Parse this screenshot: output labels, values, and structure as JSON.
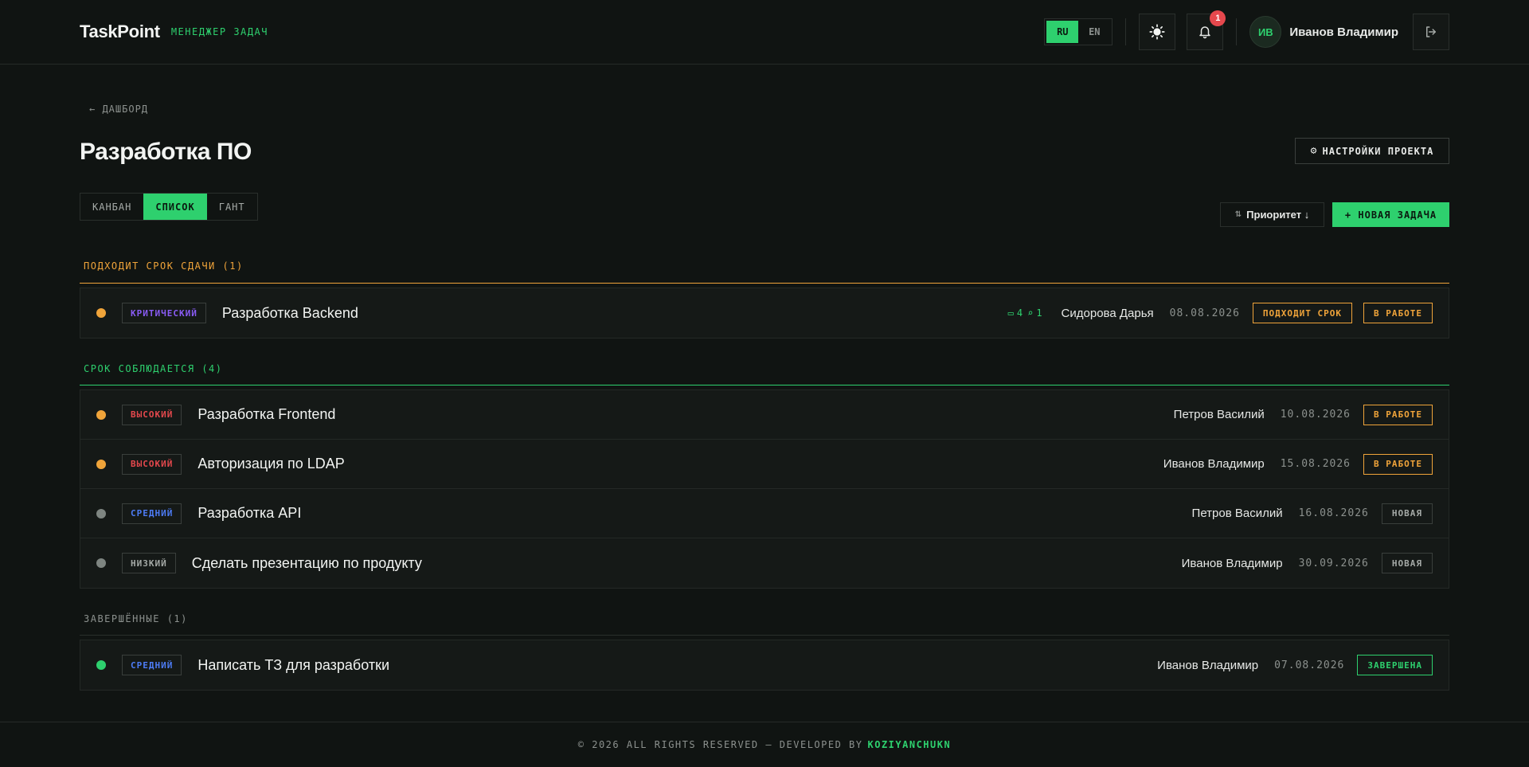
{
  "header": {
    "logo": "TaskPoint",
    "subtitle": "МЕНЕДЖЕР ЗАДАЧ",
    "lang": [
      "RU",
      "EN"
    ],
    "active_lang": "RU",
    "notifications_count": "1",
    "user_initials": "ИВ",
    "user_name": "Иванов Владимир",
    "icons": [
      "sun-icon",
      "bell-icon",
      "logout-icon"
    ]
  },
  "page": {
    "back_label": "← ДАШБОРД",
    "title": "Разработка ПО",
    "settings_label": "НАСТРОЙКИ ПРОЕКТА",
    "view_tabs": [
      "КАНБАН",
      "СПИСОК",
      "ГАНТ"
    ],
    "active_view": "СПИСОК",
    "sort_label": "Приоритет ↓",
    "new_task_label": "+ НОВАЯ ЗАДАЧА"
  },
  "groups": {
    "due_soon": {
      "label": "ПОДХОДИТ СРОК СДАЧИ (1)",
      "tasks": [
        {
          "priority": "КРИТИЧЕСКИЙ",
          "title": "Разработка Backend",
          "comments": "4",
          "attachments": "1",
          "assignee": "Сидорова Дарья",
          "date": "08.08.2026",
          "deadline_tag": "ПОДХОДИТ СРОК",
          "status": "В РАБОТЕ"
        }
      ]
    },
    "on_time": {
      "label": "СРОК СОБЛЮДАЕТСЯ (4)",
      "tasks": [
        {
          "priority": "ВЫСОКИЙ",
          "title": "Разработка Frontend",
          "assignee": "Петров Василий",
          "date": "10.08.2026",
          "status": "В РАБОТЕ"
        },
        {
          "priority": "ВЫСОКИЙ",
          "title": "Авторизация по LDAP",
          "assignee": "Иванов Владимир",
          "date": "15.08.2026",
          "status": "В РАБОТЕ"
        },
        {
          "priority": "СРЕДНИЙ",
          "title": "Разработка API",
          "assignee": "Петров Василий",
          "date": "16.08.2026",
          "status": "НОВАЯ"
        },
        {
          "priority": "НИЗКИЙ",
          "title": "Сделать презентацию по продукту",
          "assignee": "Иванов Владимир",
          "date": "30.09.2026",
          "status": "НОВАЯ"
        }
      ]
    },
    "done": {
      "label": "ЗАВЕРШЁННЫЕ (1)",
      "tasks": [
        {
          "priority": "СРЕДНИЙ",
          "title": "Написать ТЗ для разработки",
          "assignee": "Иванов Владимир",
          "date": "07.08.2026",
          "status": "ЗАВЕРШЕНА"
        }
      ]
    }
  },
  "footer": {
    "text": "© 2026 ALL RIGHTS RESERVED — DEVELOPED BY",
    "author": "KOZIYANCHUKN"
  },
  "colors": {
    "accent": "#2ed06e",
    "warning": "#f0a43a",
    "critical": "#8a5cf6",
    "high": "#e5484d",
    "medium": "#4d7cf6",
    "low": "#8c918e"
  }
}
